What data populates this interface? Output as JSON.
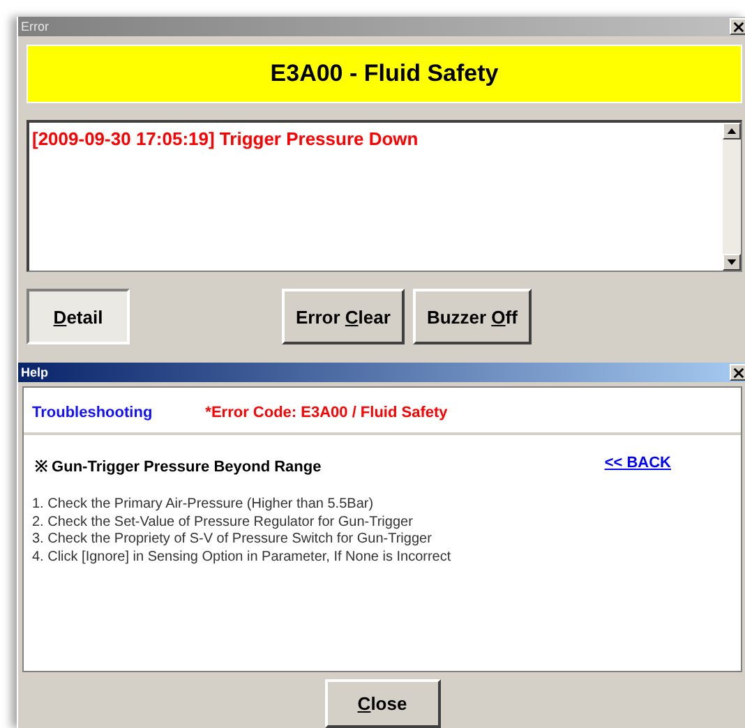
{
  "error_window": {
    "title": "Error",
    "banner": "E3A00 - Fluid Safety",
    "messages": [
      "[2009-09-30 17:05:19] Trigger Pressure Down"
    ],
    "buttons": [
      {
        "access_key": "D",
        "label_rest": "etail",
        "pressed": true
      },
      {
        "label_start": "Error ",
        "access_key": "C",
        "label_rest": "lear",
        "pressed": false
      },
      {
        "label_start": "Buzzer ",
        "access_key": "O",
        "label_rest": "ff",
        "pressed": false
      }
    ]
  },
  "help_window": {
    "title": "Help",
    "section": "Troubleshooting",
    "error_code": "*Error Code: E3A00 / Fluid Safety",
    "heading": "※ Gun-Trigger Pressure Beyond Range",
    "back_link": "<< BACK",
    "steps": [
      "1. Check the Primary Air-Pressure (Higher than 5.5Bar)",
      "2. Check the Set-Value of Pressure Regulator for Gun-Trigger",
      "3. Check the Propriety of S-V of Pressure Switch for Gun-Trigger",
      "4. Click [Ignore] in Sensing Option in Parameter, If None is Incorrect"
    ],
    "close_button": {
      "access_key": "C",
      "label_rest": "lose"
    }
  }
}
